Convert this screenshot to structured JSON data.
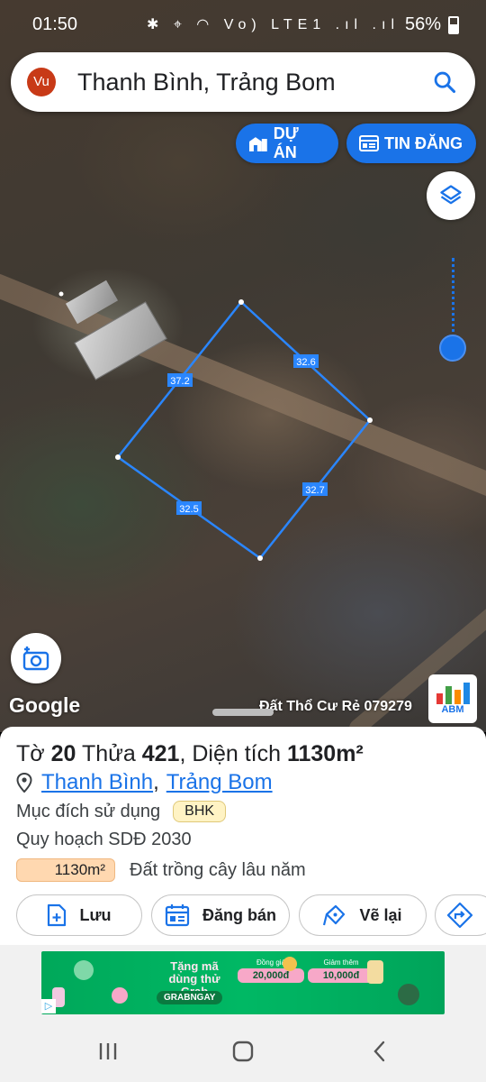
{
  "status_bar": {
    "time": "01:50",
    "icons": "✱ ⌖ ◠ Vo) LTE1 .ıl .ıl",
    "battery": "56%"
  },
  "search": {
    "avatar_initials": "Vu",
    "query": "Thanh Bình, Trảng Bom"
  },
  "chips": {
    "projects_label": "DỰ ÁN",
    "listings_label": "TIN ĐĂNG"
  },
  "map": {
    "edge_lengths": [
      "37.2",
      "32.6",
      "32.7",
      "32.5"
    ],
    "attribution": "Google",
    "watermark": "Đất Thổ Cư Rẻ 079279",
    "abm_logo_text": "ABM"
  },
  "parcel": {
    "title_prefix": "Tờ",
    "sheet_no": "20",
    "lot_label": "Thửa",
    "lot_no": "421",
    "area_label": ", Diện tích",
    "area_value": "1130m²",
    "ward": "Thanh Bình",
    "separator": ",",
    "district": "Trảng Bom",
    "purpose_label": "Mục đích sử dụng",
    "purpose_code": "BHK",
    "plan_label": "Quy hoạch SDĐ 2030",
    "plan_area": "1130m²",
    "plan_use": "Đất trồng cây lâu năm"
  },
  "actions": {
    "save": "Lưu",
    "post": "Đăng bán",
    "redraw": "Vẽ lại"
  },
  "ad": {
    "headline": "Tặng mã dùng thử Grab",
    "cta": "GRABNGAY",
    "offer1_label": "Đồng giá",
    "offer1_value": "20,000đ",
    "offer2_label": "Giảm thêm",
    "offer2_value": "10,000đ",
    "tag": "▷"
  },
  "colors": {
    "accent": "#1a73e8",
    "avatar": "#c83a17",
    "badge_bg": "#fff3c4",
    "area_pill_bg": "#ffd8b0",
    "ad_green": "#00b864"
  }
}
